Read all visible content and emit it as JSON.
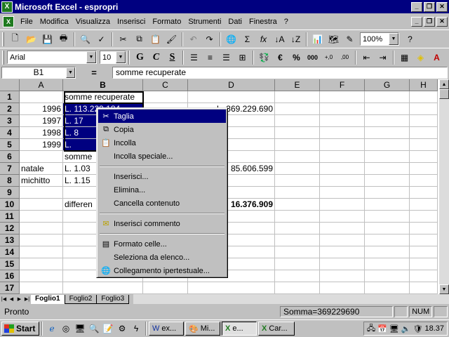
{
  "window": {
    "title": "Microsoft Excel - espropri"
  },
  "menubar": {
    "items": [
      "File",
      "Modifica",
      "Visualizza",
      "Inserisci",
      "Formato",
      "Strumenti",
      "Dati",
      "Finestra",
      "?"
    ]
  },
  "toolbar": {
    "zoom": "100%",
    "font": "Arial",
    "font_size": "10",
    "bold": "G",
    "italic": "C",
    "underline": "S",
    "currency": "€",
    "percent": "%",
    "thousands": "000",
    "autosum": "Σ",
    "function": "fx"
  },
  "formula_bar": {
    "name_box": "B1",
    "equals": "=",
    "content": "somme recuperate"
  },
  "sheet": {
    "columns": [
      "A",
      "B",
      "C",
      "D",
      "E",
      "F",
      "G",
      "H"
    ],
    "rows": [
      "1",
      "2",
      "3",
      "4",
      "5",
      "6",
      "7",
      "8",
      "9",
      "10",
      "11",
      "12",
      "13",
      "14",
      "15",
      "16",
      "17"
    ],
    "cells": {
      "B1": "somme recuperate",
      "A2": "1996",
      "B2": "L.    113.229.184",
      "D2": "L.   369.229.690",
      "A3": "1997",
      "B3": "L.    17",
      "A4": "1998",
      "B4": "L.    8",
      "A5": "1999",
      "B5": "L.",
      "B6": "somme",
      "A7": "natale",
      "B7": "L.  1.03",
      "D7": "85.606.599",
      "A8": "michitto",
      "B8": "L.  1.15",
      "B10": "differen",
      "D10": "16.376.909"
    }
  },
  "sheet_tabs": [
    "Foglio1",
    "Foglio2",
    "Foglio3"
  ],
  "status": {
    "mode": "Pronto",
    "sum": "Somma=369229690",
    "num": "NUM"
  },
  "context_menu": {
    "items": [
      {
        "label": "Taglia",
        "icon": "scissors-icon"
      },
      {
        "label": "Copia",
        "icon": "copy-icon"
      },
      {
        "label": "Incolla",
        "icon": "paste-icon"
      },
      {
        "label": "Incolla speciale...",
        "icon": ""
      },
      {
        "label": "Inserisci...",
        "icon": ""
      },
      {
        "label": "Elimina...",
        "icon": ""
      },
      {
        "label": "Cancella contenuto",
        "icon": ""
      },
      {
        "label": "Inserisci commento",
        "icon": "comment-icon"
      },
      {
        "label": "Formato celle...",
        "icon": "format-cells-icon"
      },
      {
        "label": "Seleziona da elenco...",
        "icon": ""
      },
      {
        "label": "Collegamento ipertestuale...",
        "icon": "hyperlink-icon"
      }
    ]
  },
  "taskbar": {
    "start": "Start",
    "buttons": [
      "ex...",
      "Mi...",
      "e...",
      "Car..."
    ],
    "clock": "18.37"
  },
  "colors": {
    "titlebar": "#000080",
    "selection": "#000080",
    "face": "#c0c0c0"
  }
}
